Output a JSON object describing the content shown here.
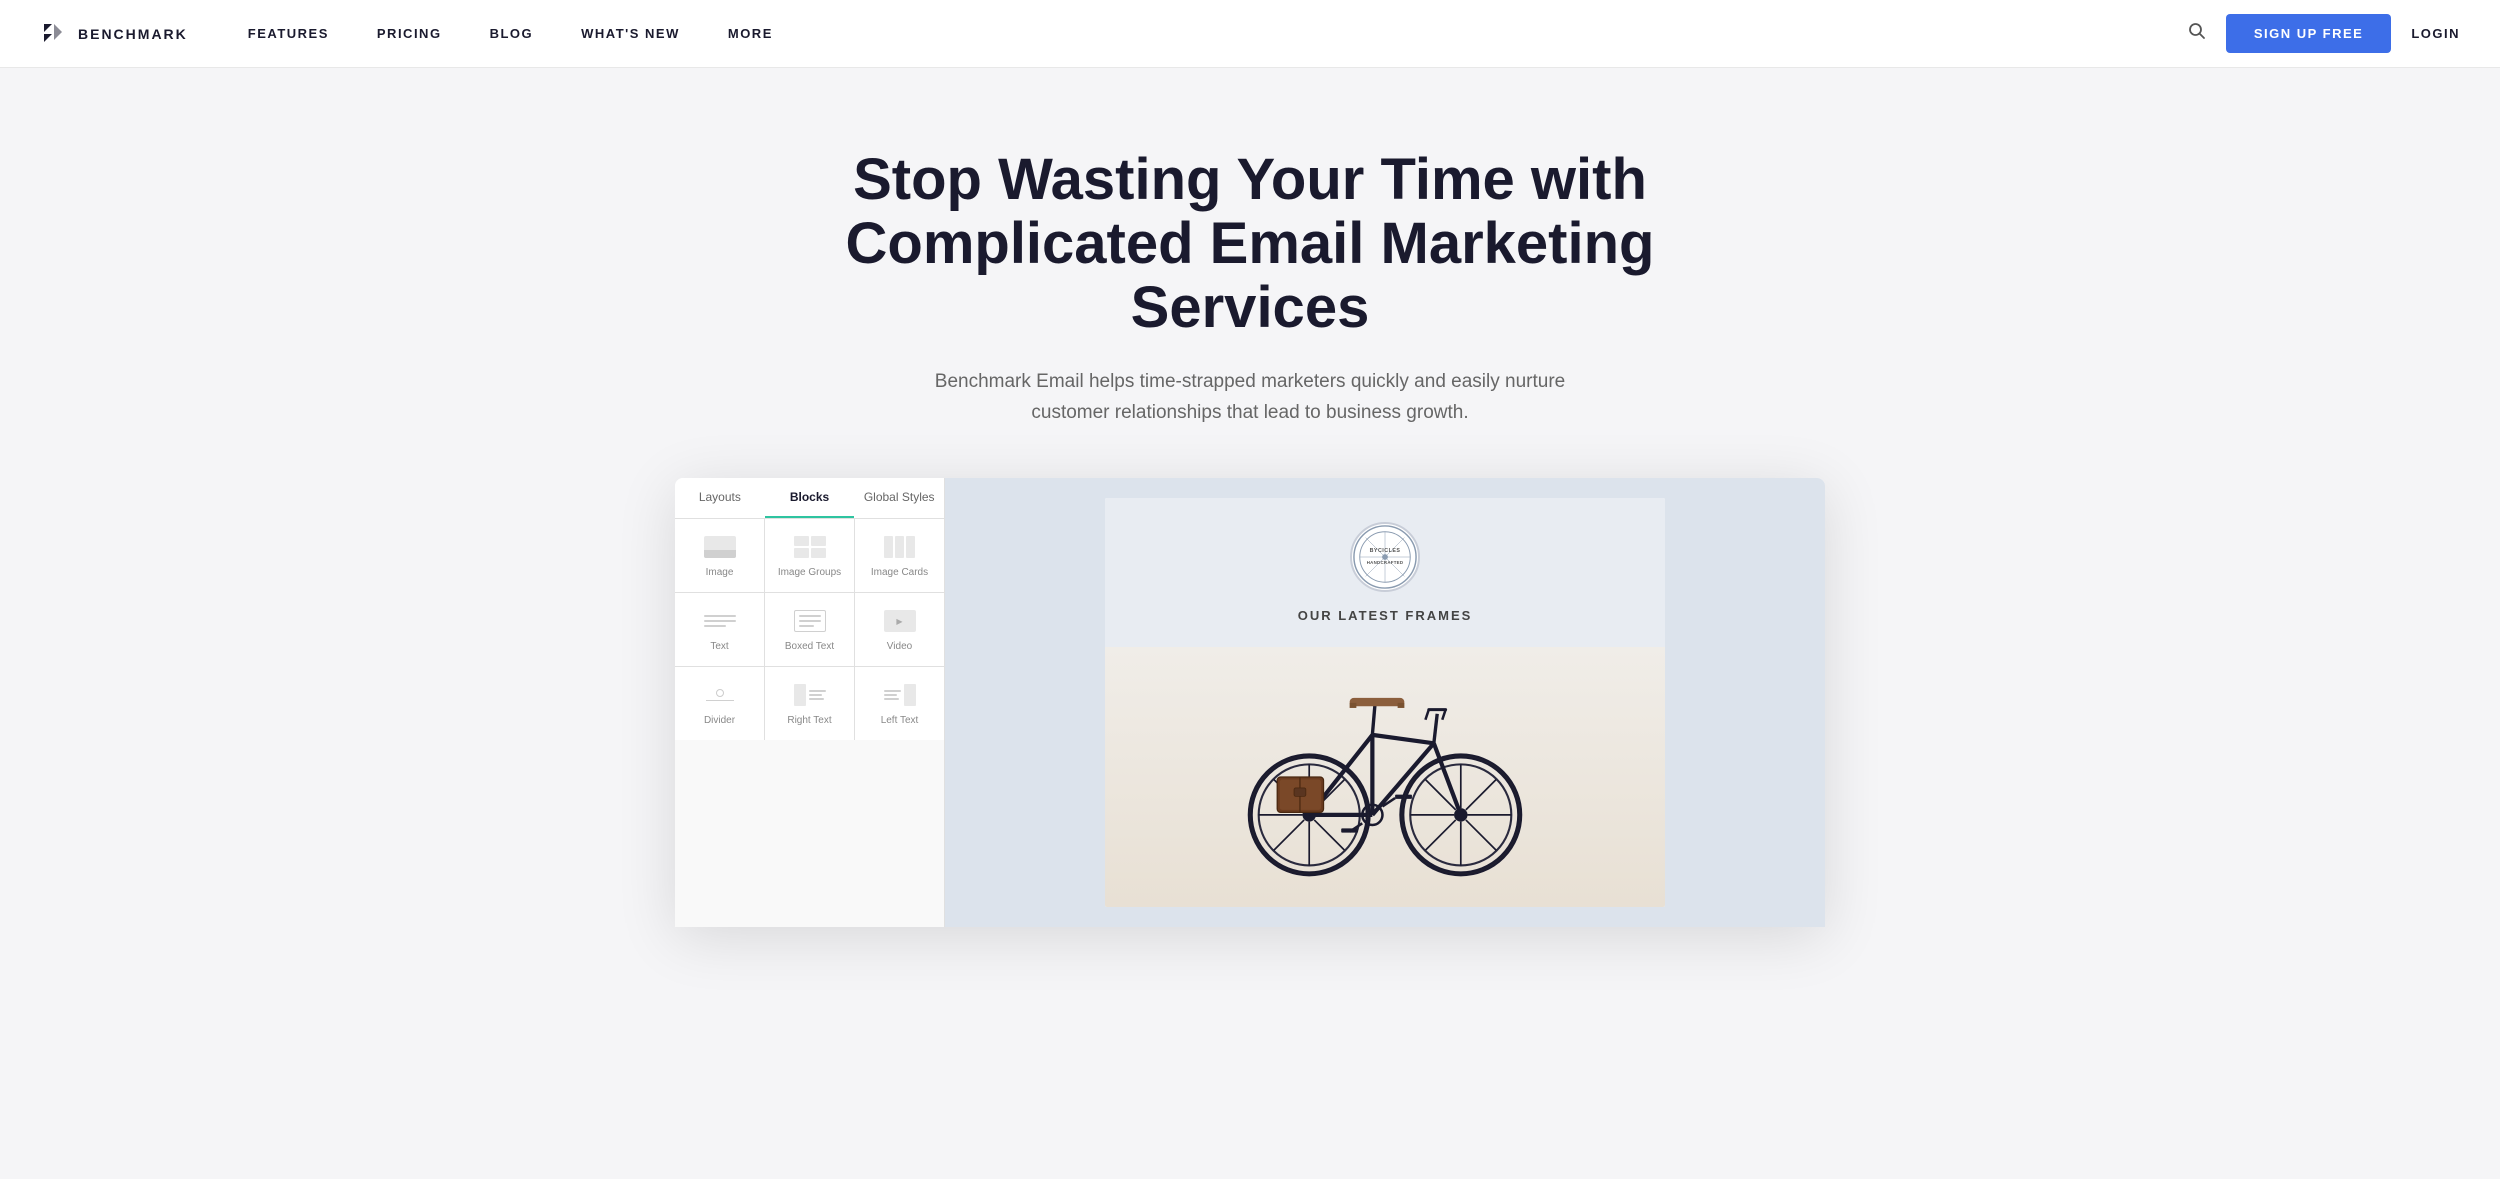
{
  "nav": {
    "logo_text": "BENCHMARK",
    "links": [
      "FEATURES",
      "PRICING",
      "BLOG",
      "WHAT'S NEW",
      "MORE"
    ],
    "signup_label": "SIGN UP FREE",
    "login_label": "LOGIN"
  },
  "hero": {
    "heading": "Stop Wasting Your Time with Complicated Email Marketing Services",
    "subtext": "Benchmark Email helps time-strapped marketers quickly and easily nurture customer relationships that lead to business growth."
  },
  "picker": {
    "tabs": [
      "Layouts",
      "Blocks",
      "Global Styles"
    ],
    "active_tab": "Blocks",
    "items": [
      {
        "label": "Image",
        "icon": "image"
      },
      {
        "label": "Image Groups",
        "icon": "image-groups"
      },
      {
        "label": "Image Cards",
        "icon": "image-cards"
      },
      {
        "label": "Text",
        "icon": "text"
      },
      {
        "label": "Boxed Text",
        "icon": "boxed-text"
      },
      {
        "label": "Video",
        "icon": "video"
      },
      {
        "label": "Divider",
        "icon": "divider"
      },
      {
        "label": "Right Text",
        "icon": "right-text"
      },
      {
        "label": "Left Text",
        "icon": "left-text"
      }
    ]
  },
  "email_preview": {
    "brand_name": "BYCICLES\nHANDCRAFTED",
    "title": "OUR LATEST FRAMES"
  }
}
